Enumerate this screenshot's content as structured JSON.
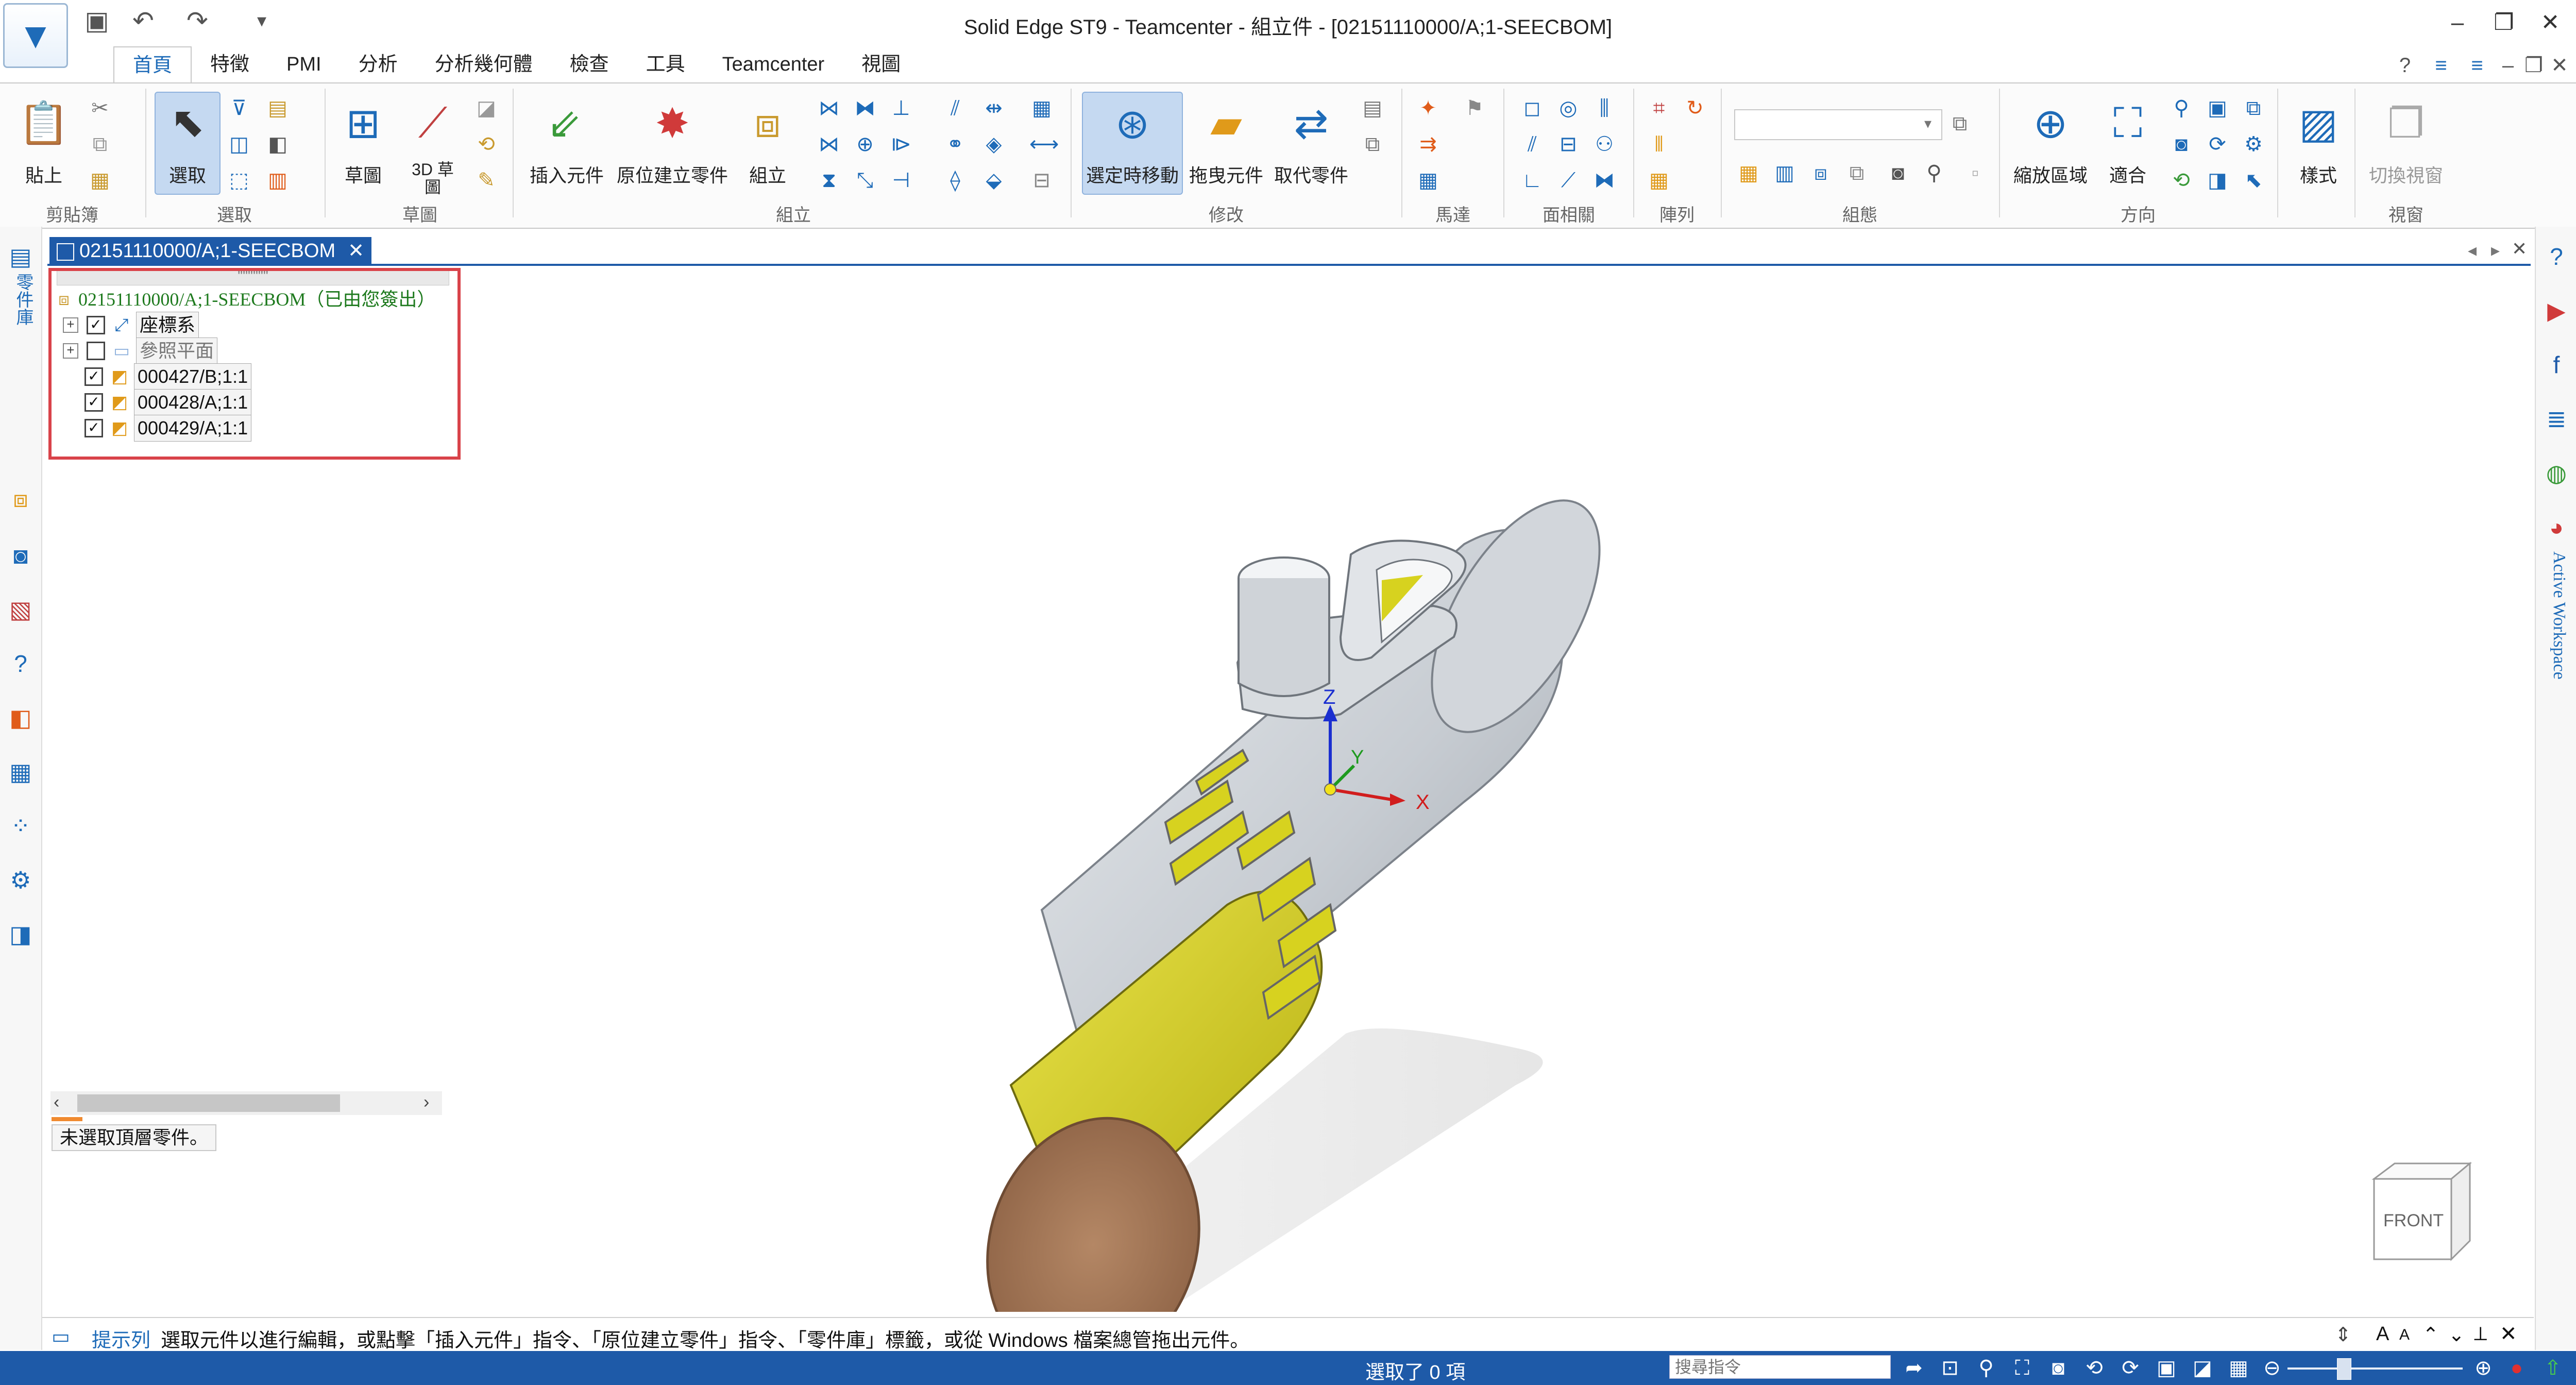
{
  "window": {
    "title": "Solid Edge ST9 - Teamcenter - 組立件 - [02151110000/A;1-SEECBOM]"
  },
  "quick_access": {
    "save_icon": "save-icon",
    "undo_icon": "undo-icon",
    "redo_icon": "redo-icon",
    "customize_icon": "customize-icon"
  },
  "tabs": [
    "首頁",
    "特徵",
    "PMI",
    "分析",
    "分析幾何體",
    "檢查",
    "工具",
    "Teamcenter",
    "視圖"
  ],
  "active_tab": "首頁",
  "ribbon": {
    "groups": [
      "剪貼簿",
      "選取",
      "草圖",
      "組立",
      "修改",
      "馬達",
      "面相關",
      "陣列",
      "組態",
      "方向",
      "視窗"
    ],
    "buttons": {
      "paste": "貼上",
      "select": "選取",
      "sketch": "草圖",
      "sketch3d": "3D 草圖",
      "insert_component": "插入元件",
      "create_in_place": "原位建立零件",
      "assemble": "組立",
      "drag_on_select": "選定時移動",
      "drag_component": "拖曳元件",
      "replace_part": "取代零件",
      "zoom_area": "縮放區域",
      "fit": "適合",
      "styles": "樣式",
      "switch_window": "切換視窗"
    }
  },
  "left_rail_label": "零件庫",
  "right_rail_label": "Active Workspace",
  "document_tab": "02151110000/A;1-SEECBOM",
  "pathfinder": {
    "root": "02151110000/A;1-SEECBOM（已由您簽出）",
    "items": [
      {
        "label": "座標系",
        "checked": true,
        "expander": "+"
      },
      {
        "label": "參照平面",
        "checked": false,
        "expander": "+"
      },
      {
        "label": "000427/B;1:1",
        "checked": true,
        "expander": ""
      },
      {
        "label": "000428/A;1:1",
        "checked": true,
        "expander": ""
      },
      {
        "label": "000429/A;1:1",
        "checked": true,
        "expander": ""
      }
    ],
    "status": "未選取頂層零件。"
  },
  "axes": {
    "x": "X",
    "y": "Y",
    "z": "Z"
  },
  "view_cube": "FRONT",
  "prompt": {
    "label": "提示列",
    "text": "選取元件以進行編輯，或點擊「插入元件」指令、「原位建立零件」指令、「零件庫」標籤，或從 Windows 檔案總管拖出元件。"
  },
  "statusbar": {
    "selected": "選取了 0 項",
    "search_placeholder": "搜尋指令"
  },
  "colors": {
    "accent": "#1e5aa8",
    "highlight": "#d9434a",
    "yellow_part": "#d7d21f",
    "brown_part": "#a27655",
    "gray_part": "#c9cdd3"
  }
}
